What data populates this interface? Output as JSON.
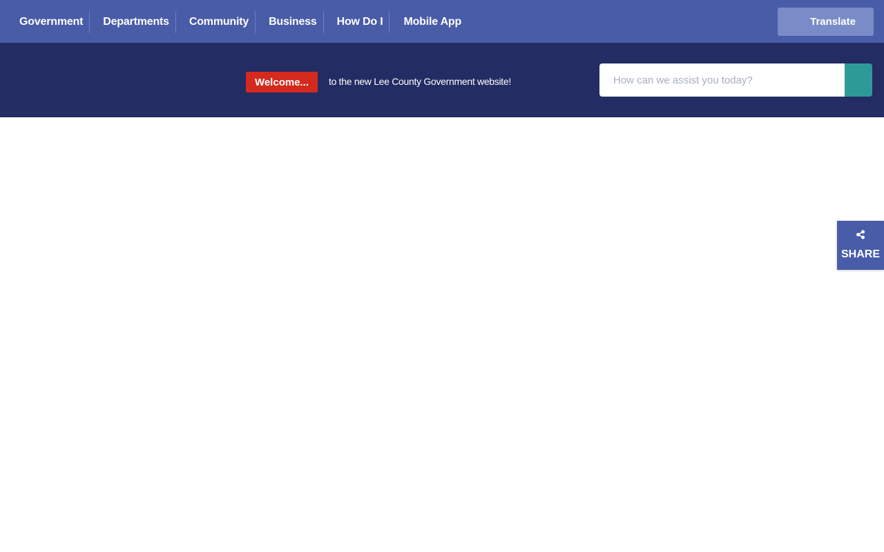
{
  "nav": {
    "items": [
      {
        "label": "Government"
      },
      {
        "label": "Departments"
      },
      {
        "label": "Community"
      },
      {
        "label": "Business"
      },
      {
        "label": "How Do I"
      },
      {
        "label": "Mobile App"
      }
    ],
    "translate_label": "Translate"
  },
  "welcome": {
    "badge": "Welcome...",
    "message": "to the new Lee County Government website!"
  },
  "search": {
    "placeholder": "How can we assist you today?",
    "value": ""
  },
  "share": {
    "label": "SHARE",
    "icon": "share-icon"
  },
  "colors": {
    "nav_bg": "#495ca8",
    "welcome_bg": "#232c63",
    "badge_red": "#d42a1e",
    "search_button": "#2e9a98",
    "translate_bg": "#7a8cc7"
  }
}
